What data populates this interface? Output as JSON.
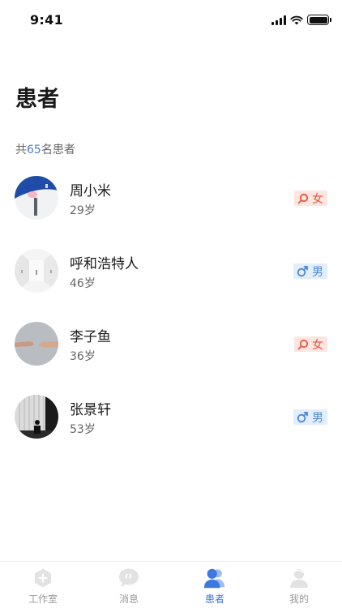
{
  "status_bar": {
    "time": "9:41"
  },
  "page": {
    "title": "患者"
  },
  "summary": {
    "prefix": "共",
    "count": "65",
    "suffix": "名患者"
  },
  "patients": [
    {
      "name": "周小米",
      "age": "29岁",
      "gender": "女",
      "gender_type": "female"
    },
    {
      "name": "呼和浩特人",
      "age": "46岁",
      "gender": "男",
      "gender_type": "male"
    },
    {
      "name": "李子鱼",
      "age": "36岁",
      "gender": "女",
      "gender_type": "female"
    },
    {
      "name": "张景轩",
      "age": "53岁",
      "gender": "男",
      "gender_type": "male"
    }
  ],
  "tab_bar": {
    "tabs": [
      {
        "label": "工作室",
        "icon": "workroom-icon"
      },
      {
        "label": "消息",
        "icon": "message-icon"
      },
      {
        "label": "患者",
        "icon": "patients-icon",
        "active": true
      },
      {
        "label": "我的",
        "icon": "profile-icon"
      }
    ]
  },
  "colors": {
    "accent": "#3d78e0",
    "count_highlight": "#4a7fd4",
    "female_text": "#e8553c",
    "female_bg": "#fde6e1",
    "male_text": "#4a86d8",
    "male_bg": "#e3eefc"
  }
}
